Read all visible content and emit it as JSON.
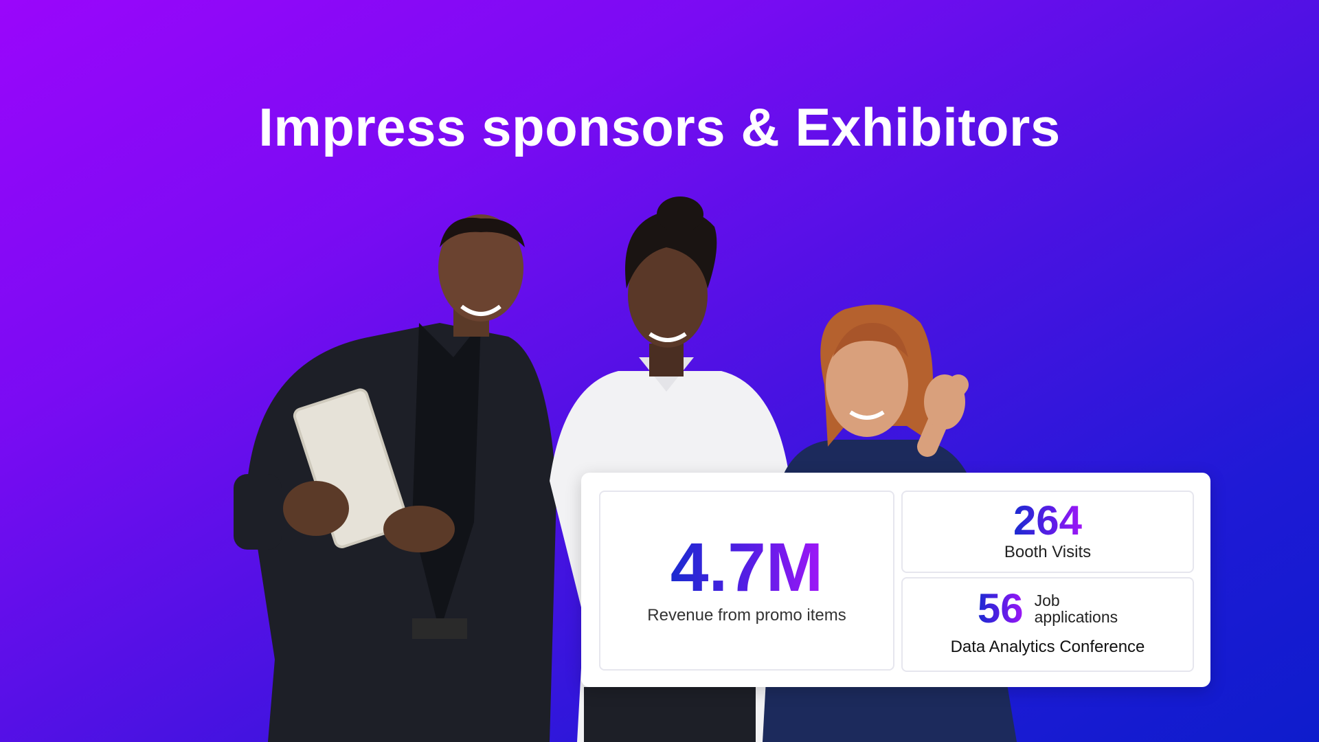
{
  "headline": "Impress sponsors & Exhibitors",
  "people": {
    "count": 3
  },
  "stats": {
    "revenue": {
      "value": "4.7M",
      "label": "Revenue from promo items"
    },
    "booth": {
      "value": "264",
      "label": "Booth Visits"
    },
    "jobs": {
      "value": "56",
      "label_line1": "Job",
      "label_line2": "applications"
    },
    "conference": "Data Analytics Conference"
  },
  "colors": {
    "background_start": "#9a06fb",
    "background_end": "#0e1ccc",
    "number_gradient_start": "#1b2bd0",
    "number_gradient_end": "#a017f7"
  }
}
